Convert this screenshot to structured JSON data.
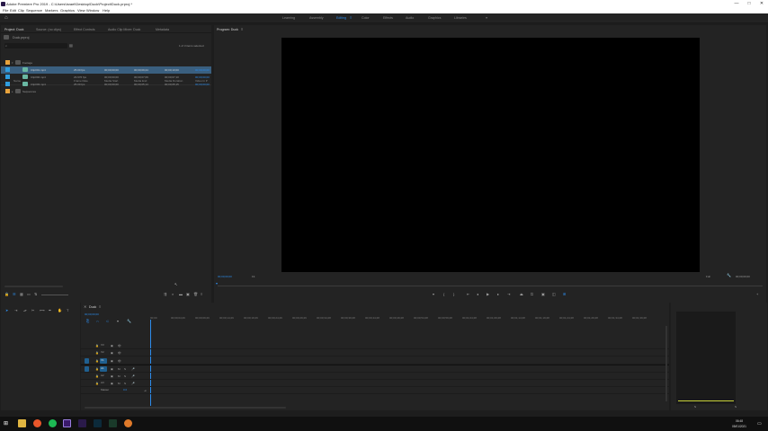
{
  "window": {
    "title": "Adobe Premiere Pro 2019 - C:\\Users\\Israel\\Desktop\\Duck\\Project\\Duck.prproj *"
  },
  "window_controls": {
    "minimize": "—",
    "maximize": "□",
    "close": "✕"
  },
  "menu": [
    "File",
    "Edit",
    "Clip",
    "Sequence",
    "Markers",
    "Graphics",
    "View",
    "Window",
    "Help"
  ],
  "workspaces": [
    "Learning",
    "Assembly",
    "Editing",
    "Color",
    "Effects",
    "Audio",
    "Graphics",
    "Libraries"
  ],
  "workspace_active": "Editing",
  "project_panel": {
    "tabs": [
      "Project: Duck",
      "Source: (no clips)",
      "Effect Controls",
      "Audio Clip Mixer: Duck",
      "Metadata"
    ],
    "bin": "Duck.prproj",
    "items_selected": "1 of 3 items selected",
    "columns": [
      "Name",
      "Frame Rate",
      "Media Start",
      "Media End",
      "Media Duration",
      "Video In P"
    ],
    "rows": [
      {
        "name": "Footage",
        "frame_rate": "",
        "start": "",
        "end": "",
        "duration": "",
        "in": "",
        "kind": "folder"
      },
      {
        "name": "Clip001.mp4",
        "frame_rate": "25.00 fps",
        "start": "00;00;00;00",
        "end": "00;00;09;24",
        "duration": "00;00;10;00",
        "in": "00;00;00;00",
        "kind": "clip"
      },
      {
        "name": "Clip002.mp4",
        "frame_rate": "23.976 fps",
        "start": "00;00;00;00",
        "end": "00;00;07;09",
        "duration": "00;00;07;10",
        "in": "00;00;00;00",
        "kind": "clip"
      },
      {
        "name": "Clip003.mp4",
        "frame_rate": "25.00 fps",
        "start": "00;00;00;00",
        "end": "00;00;05;14",
        "duration": "00;00;05;15",
        "in": "00;00;00;00",
        "kind": "clip"
      },
      {
        "name": "Sequences",
        "frame_rate": "",
        "start": "",
        "end": "",
        "duration": "",
        "in": "",
        "kind": "folder"
      }
    ]
  },
  "program_monitor": {
    "tab": "Program: Duck",
    "timecode": "00;00;00;00",
    "fit": "Fit",
    "duration": "00;00;00;00",
    "quality": "Full"
  },
  "timeline": {
    "tab": "Duck",
    "timecode": "00;00;00;00",
    "ruler": [
      "00;00",
      "00;00;04;29",
      "00;00;09;29",
      "00;00;14;29",
      "00;00;19;29",
      "00;00;24;29",
      "00;00;29;29",
      "00;00;34;28",
      "00;00;39;28",
      "00;00;44;28",
      "00;00;49;28",
      "00;00;54;28",
      "00;00;59;28",
      "00;01;04;28",
      "00;01;09;28",
      "00;01;14;28",
      "00;01;19;28",
      "00;01;24;28",
      "00;01;29;28",
      "00;01;34;28",
      "00;01;39;28",
      "00;01;44;28",
      "00;01;49;28"
    ],
    "video_tracks": [
      "V3",
      "V2",
      "V1"
    ],
    "audio_tracks": [
      "A1",
      "A2",
      "A3"
    ],
    "master": "Master",
    "master_value": "0.0"
  },
  "taskbar": {
    "time": "06:48",
    "date": "05/01/2021"
  },
  "colors": {
    "accent": "#2d8ceb",
    "panel": "#232323",
    "background": "#1d1d1d",
    "selected_row": "#3a5f7f"
  }
}
